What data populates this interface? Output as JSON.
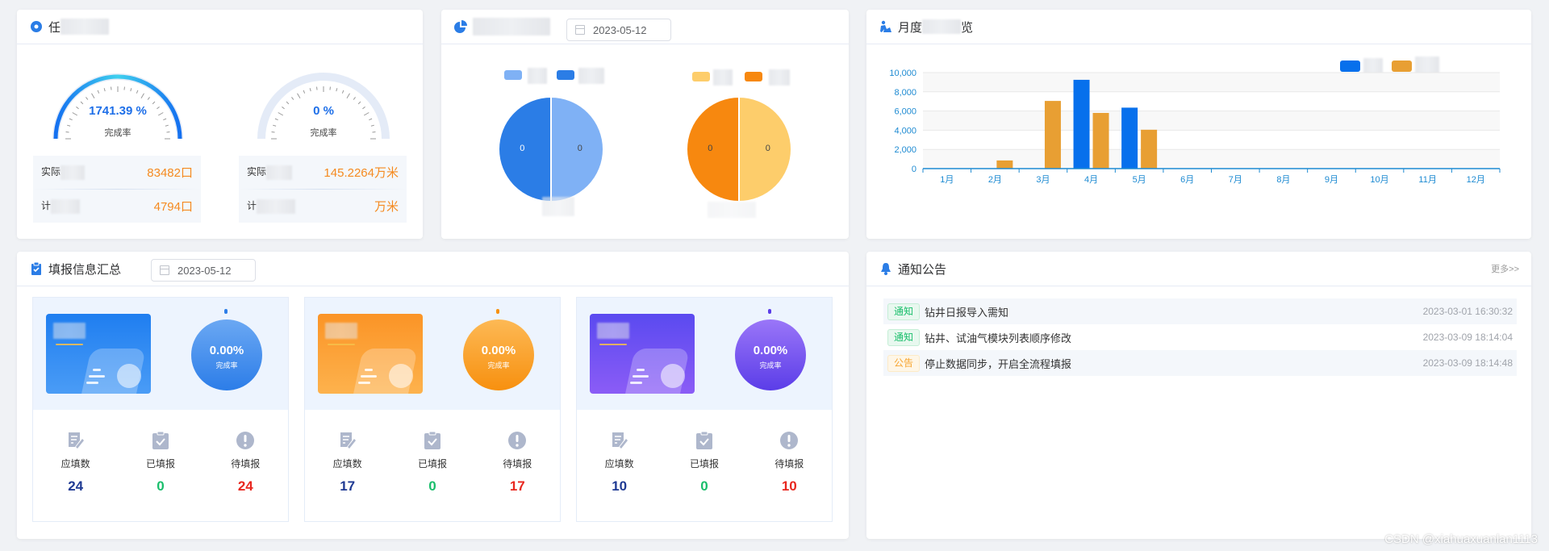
{
  "card_progress": {
    "title_visible": "任",
    "gauges": [
      {
        "value_text": "1741.39 %",
        "label": "完成率",
        "progress": 1.0
      },
      {
        "value_text": "0 %",
        "label": "完成率",
        "progress": 0
      }
    ],
    "info": [
      {
        "actual_label": "实际",
        "actual_value": "83482口",
        "plan_label": "计",
        "plan_value": "4794口"
      },
      {
        "actual_label": "实际",
        "actual_value": "145.2264万米",
        "plan_label": "计",
        "plan_value": "万米"
      }
    ]
  },
  "card_pie": {
    "date": "2023-05-12",
    "pies": [
      {
        "slices": [
          {
            "label": "0",
            "value": 1,
            "color": "#2b7de6"
          },
          {
            "label": "0",
            "value": 1,
            "color": "#7fb1f5"
          }
        ]
      },
      {
        "slices": [
          {
            "label": "0",
            "value": 1,
            "color": "#f7880f"
          },
          {
            "label": "0",
            "value": 1,
            "color": "#fdcd6b"
          }
        ]
      }
    ]
  },
  "card_monthly": {
    "title_start": "月度",
    "title_end": "览"
  },
  "chart_data": {
    "type": "bar",
    "categories": [
      "1月",
      "2月",
      "3月",
      "4月",
      "5月",
      "6月",
      "7月",
      "8月",
      "9月",
      "10月",
      "11月",
      "12月"
    ],
    "series": [
      {
        "name": "",
        "color": "#0770ec",
        "values": [
          0,
          0,
          0,
          9250,
          6350,
          0,
          0,
          0,
          0,
          0,
          0,
          0
        ]
      },
      {
        "name": "",
        "color": "#e89f33",
        "values": [
          0,
          850,
          7050,
          5800,
          4050,
          0,
          0,
          0,
          0,
          0,
          0,
          0
        ]
      }
    ],
    "yticks": [
      "0",
      "2,000",
      "4,000",
      "6,000",
      "8,000",
      "10,000"
    ],
    "ylim": [
      0,
      10000
    ],
    "grid": true,
    "legend": "top-right"
  },
  "card_fill": {
    "title": "填报信息汇总",
    "date": "2023-05-12",
    "panels": [
      {
        "percent": "0.00%",
        "rate_label": "完成率",
        "theme": "blue",
        "stats": [
          {
            "label": "应填数",
            "value": "24"
          },
          {
            "label": "已填报",
            "value": "0"
          },
          {
            "label": "待填报",
            "value": "24"
          }
        ]
      },
      {
        "percent": "0.00%",
        "rate_label": "完成率",
        "theme": "orange",
        "stats": [
          {
            "label": "应填数",
            "value": "17"
          },
          {
            "label": "已填报",
            "value": "0"
          },
          {
            "label": "待填报",
            "value": "17"
          }
        ]
      },
      {
        "percent": "0.00%",
        "rate_label": "完成率",
        "theme": "purple",
        "stats": [
          {
            "label": "应填数",
            "value": "10"
          },
          {
            "label": "已填报",
            "value": "0"
          },
          {
            "label": "待填报",
            "value": "10"
          }
        ]
      }
    ]
  },
  "card_notice": {
    "title": "通知公告",
    "more": "更多>>",
    "items": [
      {
        "tag": "通知",
        "text": "钻井日报导入需知",
        "time": "2023-03-01 16:30:32"
      },
      {
        "tag": "通知",
        "text": "钻井、试油气模块列表顺序修改",
        "time": "2023-03-09 18:14:04"
      },
      {
        "tag": "公告",
        "text": "停止数据同步，开启全流程填报",
        "time": "2023-03-09 18:14:48"
      }
    ]
  },
  "watermark": "CSDN @xiahuaxuanlan1113"
}
